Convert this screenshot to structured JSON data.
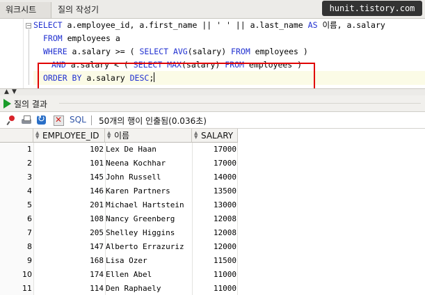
{
  "tabs": [
    {
      "label": "워크시트"
    },
    {
      "label": "질의 작성기"
    }
  ],
  "watermark": "hunit.tistory.com",
  "editor": {
    "lines": [
      {
        "tokens": [
          [
            "kw",
            "SELECT "
          ],
          [
            "id",
            "a.employee_id, a.first_name || ' ' || a.last_name "
          ],
          [
            "kw",
            "AS "
          ],
          [
            "id",
            "이름, a.salary"
          ]
        ]
      },
      {
        "tokens": [
          [
            "kw",
            "FROM "
          ],
          [
            "id",
            "employees a"
          ]
        ]
      },
      {
        "tokens": [
          [
            "kw",
            "WHERE "
          ],
          [
            "id",
            "a.salary >= ( "
          ],
          [
            "kw",
            "SELECT AVG"
          ],
          [
            "id",
            "(salary) "
          ],
          [
            "kw",
            "FROM "
          ],
          [
            "id",
            "employees )"
          ]
        ]
      },
      {
        "tokens": [
          [
            "kw",
            "AND "
          ],
          [
            "id",
            "a.salary < ( "
          ],
          [
            "kw",
            "SELECT MAX"
          ],
          [
            "id",
            "(salary) "
          ],
          [
            "kw",
            "FROM "
          ],
          [
            "id",
            "employees )"
          ]
        ]
      },
      {
        "tokens": [
          [
            "kw",
            "ORDER BY "
          ],
          [
            "id",
            "a.salary "
          ],
          [
            "kw",
            "DESC"
          ],
          [
            "id",
            ";"
          ]
        ]
      }
    ]
  },
  "results": {
    "tab_label": "질의 결과",
    "toolbar": {
      "sql_label": "SQL",
      "status": "50개의 행이 인출됨(0.036초)"
    },
    "columns": [
      "EMPLOYEE_ID",
      "이름",
      "SALARY"
    ],
    "rows": [
      {
        "n": "1",
        "id": "102",
        "name": "Lex De Haan",
        "salary": "17000"
      },
      {
        "n": "2",
        "id": "101",
        "name": "Neena Kochhar",
        "salary": "17000"
      },
      {
        "n": "3",
        "id": "145",
        "name": "John Russell",
        "salary": "14000"
      },
      {
        "n": "4",
        "id": "146",
        "name": "Karen Partners",
        "salary": "13500"
      },
      {
        "n": "5",
        "id": "201",
        "name": "Michael Hartstein",
        "salary": "13000"
      },
      {
        "n": "6",
        "id": "108",
        "name": "Nancy Greenberg",
        "salary": "12008"
      },
      {
        "n": "7",
        "id": "205",
        "name": "Shelley Higgins",
        "salary": "12008"
      },
      {
        "n": "8",
        "id": "147",
        "name": "Alberto Errazuriz",
        "salary": "12000"
      },
      {
        "n": "9",
        "id": "168",
        "name": "Lisa Ozer",
        "salary": "11500"
      },
      {
        "n": "10",
        "id": "174",
        "name": "Ellen Abel",
        "salary": "11000"
      },
      {
        "n": "11",
        "id": "114",
        "name": "Den Raphaely",
        "salary": "11000"
      }
    ]
  },
  "colors": {
    "highlight_box": "#e00000",
    "keyword": "#1f2fd0",
    "run_icon": "#1a9c2a"
  }
}
